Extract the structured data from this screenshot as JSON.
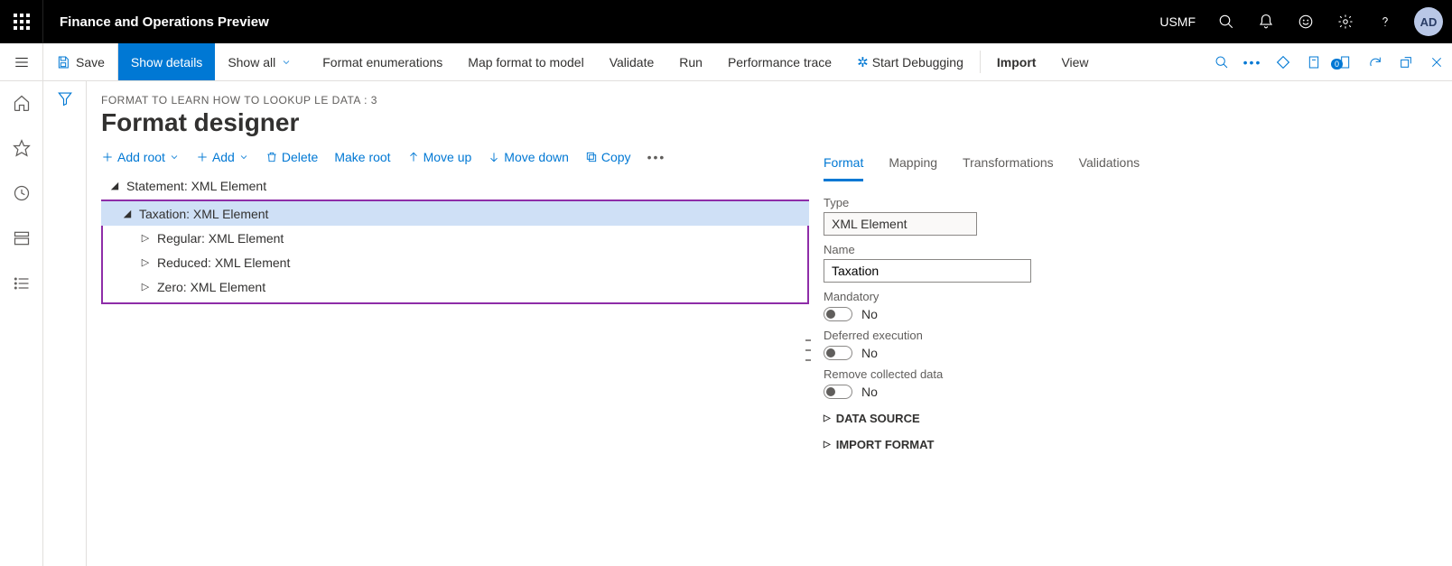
{
  "topbar": {
    "title": "Finance and Operations Preview",
    "company": "USMF",
    "avatar": "AD"
  },
  "cmdbar": {
    "save": "Save",
    "show_details": "Show details",
    "show_all": "Show all",
    "format_enum": "Format enumerations",
    "map_format": "Map format to model",
    "validate": "Validate",
    "run": "Run",
    "perf_trace": "Performance trace",
    "start_debug": "Start Debugging",
    "import": "Import",
    "view": "View",
    "attach_badge": "0"
  },
  "page": {
    "breadcrumb": "FORMAT TO LEARN HOW TO LOOKUP LE DATA : 3",
    "title": "Format designer"
  },
  "treetoolbar": {
    "add_root": "Add root",
    "add": "Add",
    "delete": "Delete",
    "make_root": "Make root",
    "move_up": "Move up",
    "move_down": "Move down",
    "copy": "Copy"
  },
  "tree": {
    "root": "Statement: XML Element",
    "taxation": "Taxation: XML Element",
    "regular": "Regular: XML Element",
    "reduced": "Reduced: XML Element",
    "zero": "Zero: XML Element"
  },
  "tabs": {
    "format": "Format",
    "mapping": "Mapping",
    "transformations": "Transformations",
    "validations": "Validations"
  },
  "props": {
    "type_label": "Type",
    "type_value": "XML Element",
    "name_label": "Name",
    "name_value": "Taxation",
    "mandatory_label": "Mandatory",
    "mandatory_value": "No",
    "deferred_label": "Deferred execution",
    "deferred_value": "No",
    "remove_label": "Remove collected data",
    "remove_value": "No",
    "data_source": "DATA SOURCE",
    "import_format": "IMPORT FORMAT"
  }
}
